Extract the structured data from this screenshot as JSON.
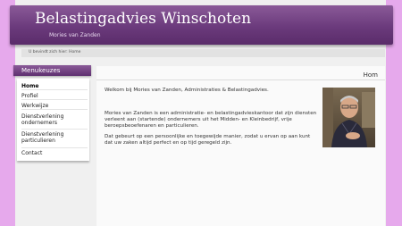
{
  "header": {
    "title": "Belastingadvies Winschoten",
    "subtitle": "Mories van Zanden"
  },
  "breadcrumb": {
    "text": "U bevindt zich hier: Home"
  },
  "sidebar": {
    "title": "Menukeuzes",
    "items": [
      {
        "label": "Home",
        "active": true
      },
      {
        "label": "Profiel",
        "active": false
      },
      {
        "label": "Werkwijze",
        "active": false
      },
      {
        "label": "Dienstverlening",
        "label2": "ondernemers",
        "active": false
      },
      {
        "label": "Dienstverlening",
        "label2": "particulieren",
        "active": false
      },
      {
        "label": "Contact",
        "active": false
      }
    ]
  },
  "main": {
    "heading": "Hom",
    "welcome": "Welkom bij Mories van Zanden, Administraties & Belastingadvies.",
    "intro_line1": "Mories van Zanden is een administratie- en belastingadvieskantoor dat zijn diensten",
    "intro_line2": "verleent aan (startende) ondernemers uit het Midden- en Kleinbedrijf, vrije",
    "intro_line3": "beroepsbeoefenaren en particulieren.",
    "outro_line1": "Dat gebeurt op een persoonlijke en toegewijde manier, zodat u ervan op aan kunt",
    "outro_line2": "dat uw zaken altijd perfect en op tijd geregeld zijn."
  },
  "colors": {
    "background": "#e6a9ec",
    "banner": "#6b3a7c",
    "page": "#f0f0f0"
  }
}
